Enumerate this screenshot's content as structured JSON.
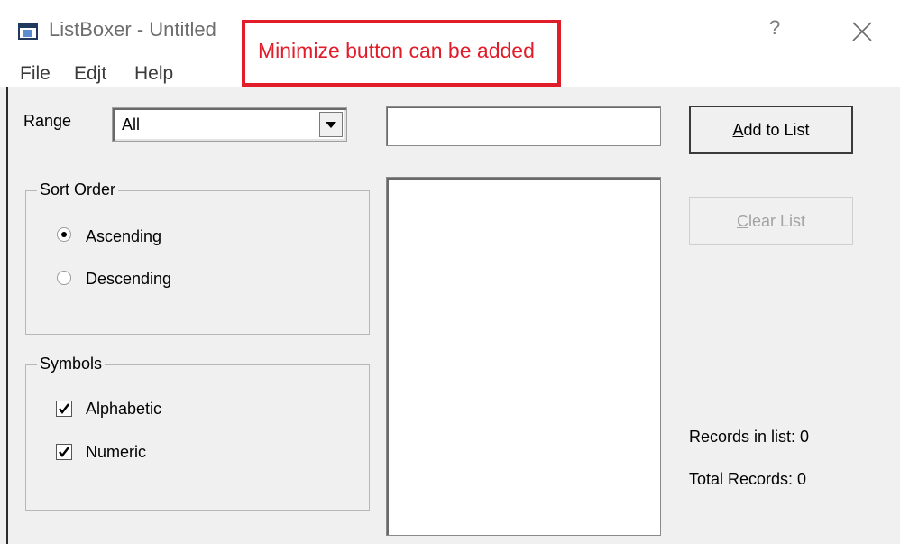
{
  "window": {
    "title": "ListBoxer - Untitled",
    "help_glyph": "?",
    "close_icon": "close-icon"
  },
  "menu": {
    "file": "File",
    "edit": "Edjt",
    "help": "Help"
  },
  "annotation": {
    "text": "Minimize button can be added",
    "color": "#e21d2a"
  },
  "range": {
    "label": "Range",
    "selected": "All"
  },
  "sort_order": {
    "title": "Sort Order",
    "ascending": "Ascending",
    "descending": "Descending",
    "selected": "Ascending"
  },
  "symbols": {
    "title": "Symbols",
    "alphabetic": "Alphabetic",
    "numeric": "Numeric",
    "alphabetic_checked": true,
    "numeric_checked": true
  },
  "input": {
    "value": ""
  },
  "buttons": {
    "add": "Add to List",
    "clear": "Clear List",
    "clear_enabled": false
  },
  "status": {
    "records_in_list": "Records in list: 0",
    "total_records": "Total Records: 0"
  }
}
